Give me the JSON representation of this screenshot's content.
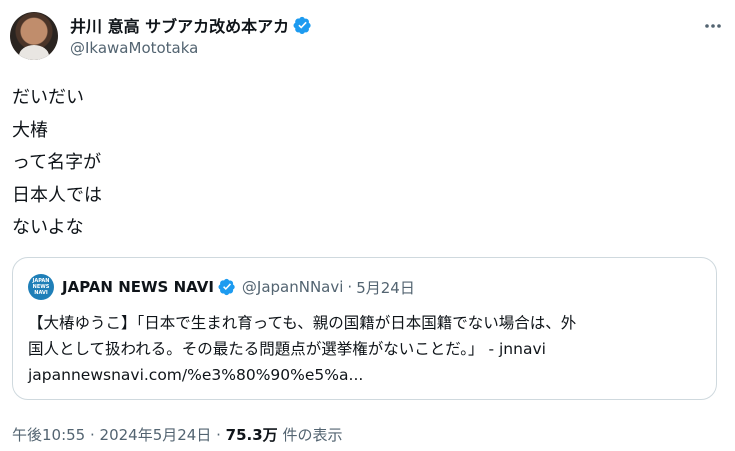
{
  "author": {
    "display_name": "井川 意高 サブアカ改め本アカ",
    "handle": "@IkawaMototaka",
    "verified_color": "#1d9bf0"
  },
  "tweet": {
    "lines": [
      "だいだい",
      "大椿",
      "って名字が",
      "日本人では",
      "ないよな"
    ]
  },
  "quoted_tweet": {
    "avatar_text": [
      "JAPAN",
      "NEWS",
      "NAVI"
    ],
    "display_name": "JAPAN NEWS NAVI",
    "handle": "@JapanNNavi",
    "separator": "·",
    "date": "5月24日",
    "text_lines": [
      "【大椿ゆうこ】「日本で生まれ育っても、親の国籍が日本国籍でない場合は、外",
      "国人として扱われる。その最たる問題点が選挙権がないことだ。」 - jnnavi",
      "japannewsnavi.com/%e3%80%90%e5%a..."
    ]
  },
  "meta": {
    "time": "午後10:55",
    "separator": " · ",
    "date": "2024年5月24日",
    "views_count": "75.3万",
    "views_label": " 件の表示"
  },
  "icons": {
    "verified": "verified-badge-icon",
    "more": "more-options-icon"
  }
}
